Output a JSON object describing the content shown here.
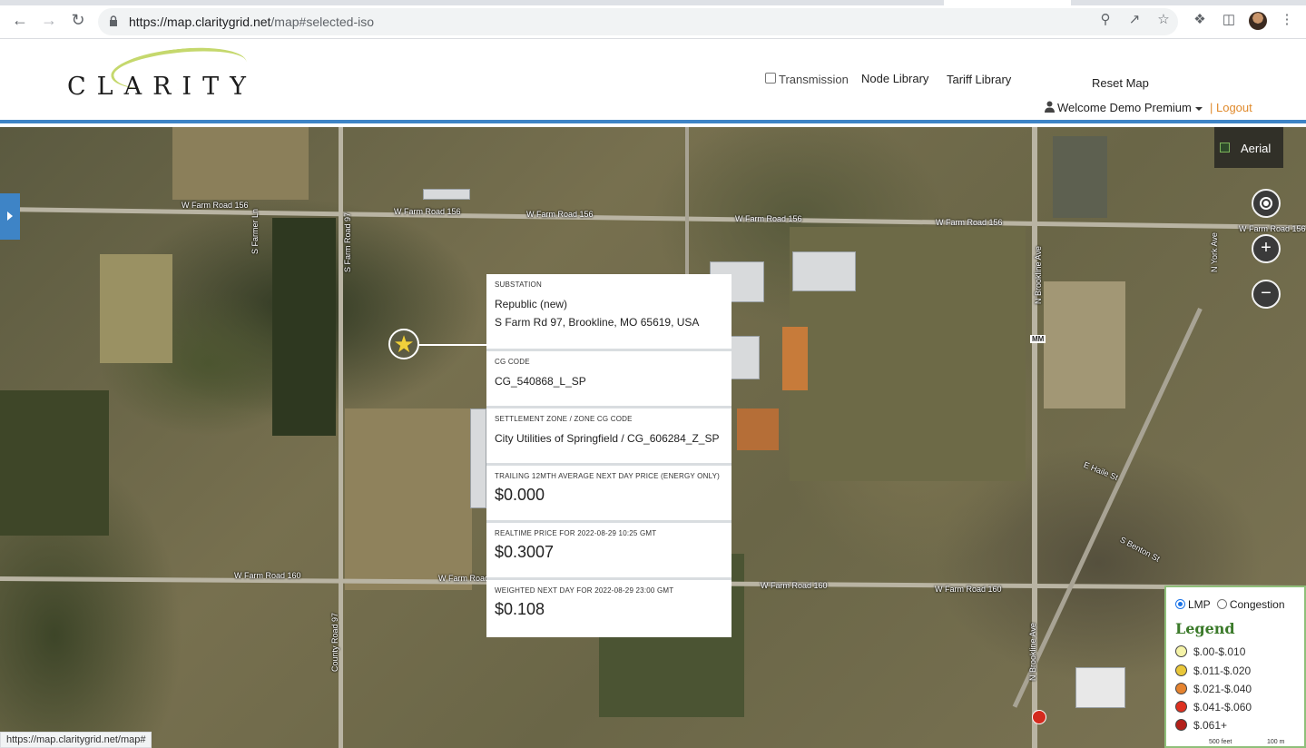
{
  "browser": {
    "url_host": "https://map.claritygrid.net",
    "url_path": "/map#selected-iso",
    "status_url": "https://map.claritygrid.net/map#"
  },
  "header": {
    "logo_text": "CLARITY",
    "transmission_label": "Transmission",
    "node_library": "Node Library",
    "tariff_library": "Tariff Library",
    "reset_map": "Reset Map",
    "welcome": "Welcome Demo Premium",
    "logout": "| Logout",
    "colors": {
      "accent": "#3e84c6",
      "logout": "#e08a2c",
      "legend_title": "#3b7a2a"
    }
  },
  "map": {
    "aerial_label": "Aerial",
    "controls": {
      "locate": "locate-icon",
      "zoom_in": "+",
      "zoom_out": "−"
    },
    "road_labels": [
      "W Farm Road 156",
      "W Farm Road 156",
      "W Farm Road 156",
      "W Farm Road 156",
      "W Farm Road 156",
      "W Farm Road 156",
      "W Farm Road 160",
      "W Farm Road 160",
      "W Farm Road 160",
      "W Farm Road 160",
      "S Farm Road 97",
      "County Road 97",
      "N Brookline Ave",
      "N Brookline Ave",
      "N York Ave",
      "S Farmer Ln",
      "E Haile St",
      "S Benton St",
      "MM"
    ],
    "scale": [
      "500 feet",
      "100 m"
    ]
  },
  "info": {
    "substation_cap": "SUBSTATION",
    "substation_name": "Republic (new)",
    "substation_address": "S Farm Rd 97, Brookline, MO 65619, USA",
    "cg_code_cap": "CG CODE",
    "cg_code": "CG_540868_L_SP",
    "zone_cap": "SETTLEMENT ZONE / ZONE CG CODE",
    "zone": "City Utilities of Springfield / CG_606284_Z_SP",
    "trailing_cap": "TRAILING 12mth AVERAGE NEXT DAY PRICE (Energy only)",
    "trailing": "$0.000",
    "realtime_cap": "REALTIME PRICE FOR 2022-08-29 10:25 GMT",
    "realtime": "$0.3007",
    "weighted_cap": "WEIGHTED NEXT DAY FOR 2022-08-29 23:00 GMT",
    "weighted": "$0.108"
  },
  "legend": {
    "lmp": "LMP",
    "congestion": "Congestion",
    "title": "Legend",
    "items": [
      {
        "label": "$.00-$.010",
        "color": "#f5f3a8"
      },
      {
        "label": "$.011-$.020",
        "color": "#e9c73a"
      },
      {
        "label": "$.021-$.040",
        "color": "#e5832f"
      },
      {
        "label": "$.041-$.060",
        "color": "#dd3020"
      },
      {
        "label": "$.061+",
        "color": "#b3201a"
      }
    ]
  }
}
